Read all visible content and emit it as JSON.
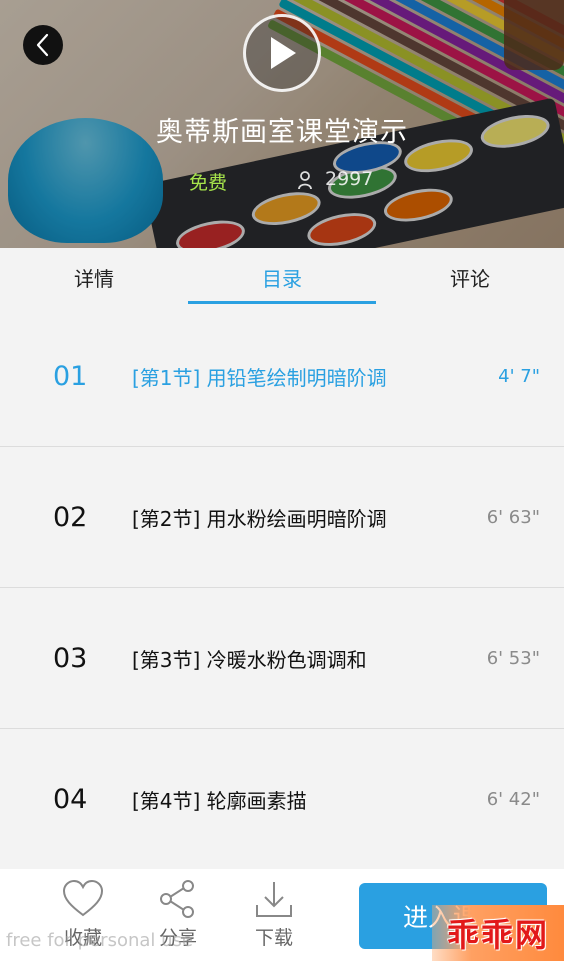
{
  "header": {
    "title": "奥蒂斯画室课堂演示",
    "price": "免费",
    "views": "2997",
    "back_icon": "chevron-left-icon",
    "play_icon": "play-icon",
    "view_icon": "person-icon"
  },
  "tabs": [
    {
      "label": "详情",
      "active": false
    },
    {
      "label": "目录",
      "active": true
    },
    {
      "label": "评论",
      "active": false
    }
  ],
  "lessons": [
    {
      "num": "01",
      "title": "[第1节] 用铅笔绘制明暗阶调",
      "duration": "4' 7\"",
      "active": true
    },
    {
      "num": "02",
      "title": "[第2节] 用水粉绘画明暗阶调",
      "duration": "6' 63\"",
      "active": false
    },
    {
      "num": "03",
      "title": "[第3节] 冷暖水粉色调调和",
      "duration": "6' 53\"",
      "active": false
    },
    {
      "num": "04",
      "title": "[第4节] 轮廓画素描",
      "duration": "6' 42\"",
      "active": false
    }
  ],
  "bottombar": {
    "favorite_label": "收藏",
    "share_label": "分享",
    "download_label": "下载",
    "enter_label": "进入课程"
  },
  "watermark": {
    "text": "free for personal use",
    "logo_text": "乖乖网"
  },
  "colors": {
    "accent": "#2aa0e1",
    "price": "#a6e44b",
    "logo": "#e21919"
  }
}
